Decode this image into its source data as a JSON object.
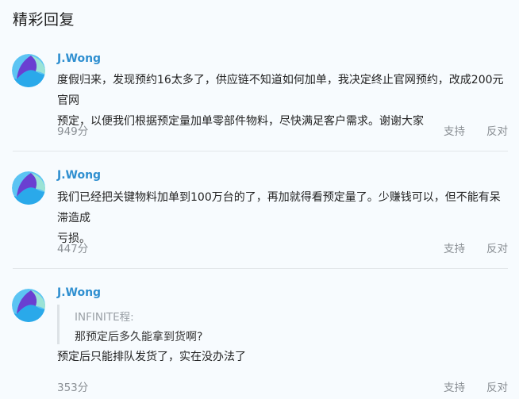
{
  "section": {
    "title": "精彩回复"
  },
  "actions": {
    "support": "支持",
    "oppose": "反对"
  },
  "comments": [
    {
      "author": "J.Wong",
      "lines": [
        "度假归来，发现预约16太多了，供应链不知道如何加单，我决定终止官网预约，改成200元官网",
        "预定，以便我们根据预定量加单零部件物料，尽快满足客户需求。谢谢大家"
      ],
      "score": "949分"
    },
    {
      "author": "J.Wong",
      "lines": [
        "我们已经把关键物料加单到100万台的了，再加就得看预定量了。少赚钱可以，但不能有呆滞造成",
        "亏损。"
      ],
      "score": "447分"
    },
    {
      "author": "J.Wong",
      "quote": {
        "author": "INFINITE程:",
        "text": "那预定后多久能拿到货啊?"
      },
      "lines": [
        "预定后只能排队发货了，实在没办法了"
      ],
      "score": "353分"
    }
  ]
}
